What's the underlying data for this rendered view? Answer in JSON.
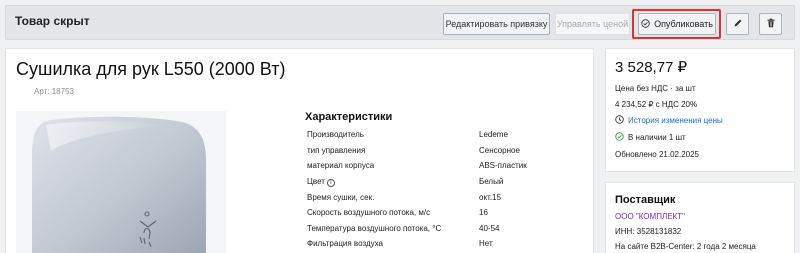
{
  "header": {
    "status": "Товар скрыт",
    "edit_binding": "Редактировать привязку",
    "manage_price": "Управлять ценой",
    "publish": "Опубликовать",
    "icons": [
      "check-circle-icon",
      "pencil-icon",
      "trash-icon"
    ]
  },
  "product": {
    "title": "Сушилка для рук L550 (2000 Вт)",
    "sku": "Арт: 18753"
  },
  "specs": {
    "title": "Характеристики",
    "rows": [
      {
        "key": "Производитель",
        "value": "Ledeme"
      },
      {
        "key": "тип управления",
        "value": "Сенсорное"
      },
      {
        "key": "материал корпуса",
        "value": "ABS-пластик"
      },
      {
        "key": "Цвет",
        "value": "Белый"
      },
      {
        "key": "Время сушки, сек.",
        "value": "окт.15"
      },
      {
        "key": "Скорость воздушного потока, м/с",
        "value": "16"
      },
      {
        "key": "Температура воздушного потока, °С",
        "value": "40-54"
      },
      {
        "key": "Фильтрация воздуха",
        "value": "Нет"
      }
    ]
  },
  "pricing": {
    "price": "3 528,77 ₽",
    "no_vat": "Цена без НДС · за шт",
    "with_vat": "4 234,52 ₽ с НДС 20%",
    "history": "История изменения цены",
    "stock": "В наличии 1 шт",
    "updated": "Обновлено 21.02.2025"
  },
  "supplier": {
    "title": "Поставщик",
    "name": "ООО \"КОМПЛЕКТ\"",
    "inn": "ИНН: 3528131832",
    "since": "На сайте B2B-Center: 2 года 2 месяца"
  },
  "colors": {
    "highlight": "#e03131",
    "link": "#1a6fc9",
    "supplier_link": "#6b2fb3",
    "stock_ok": "#3aa04a"
  }
}
